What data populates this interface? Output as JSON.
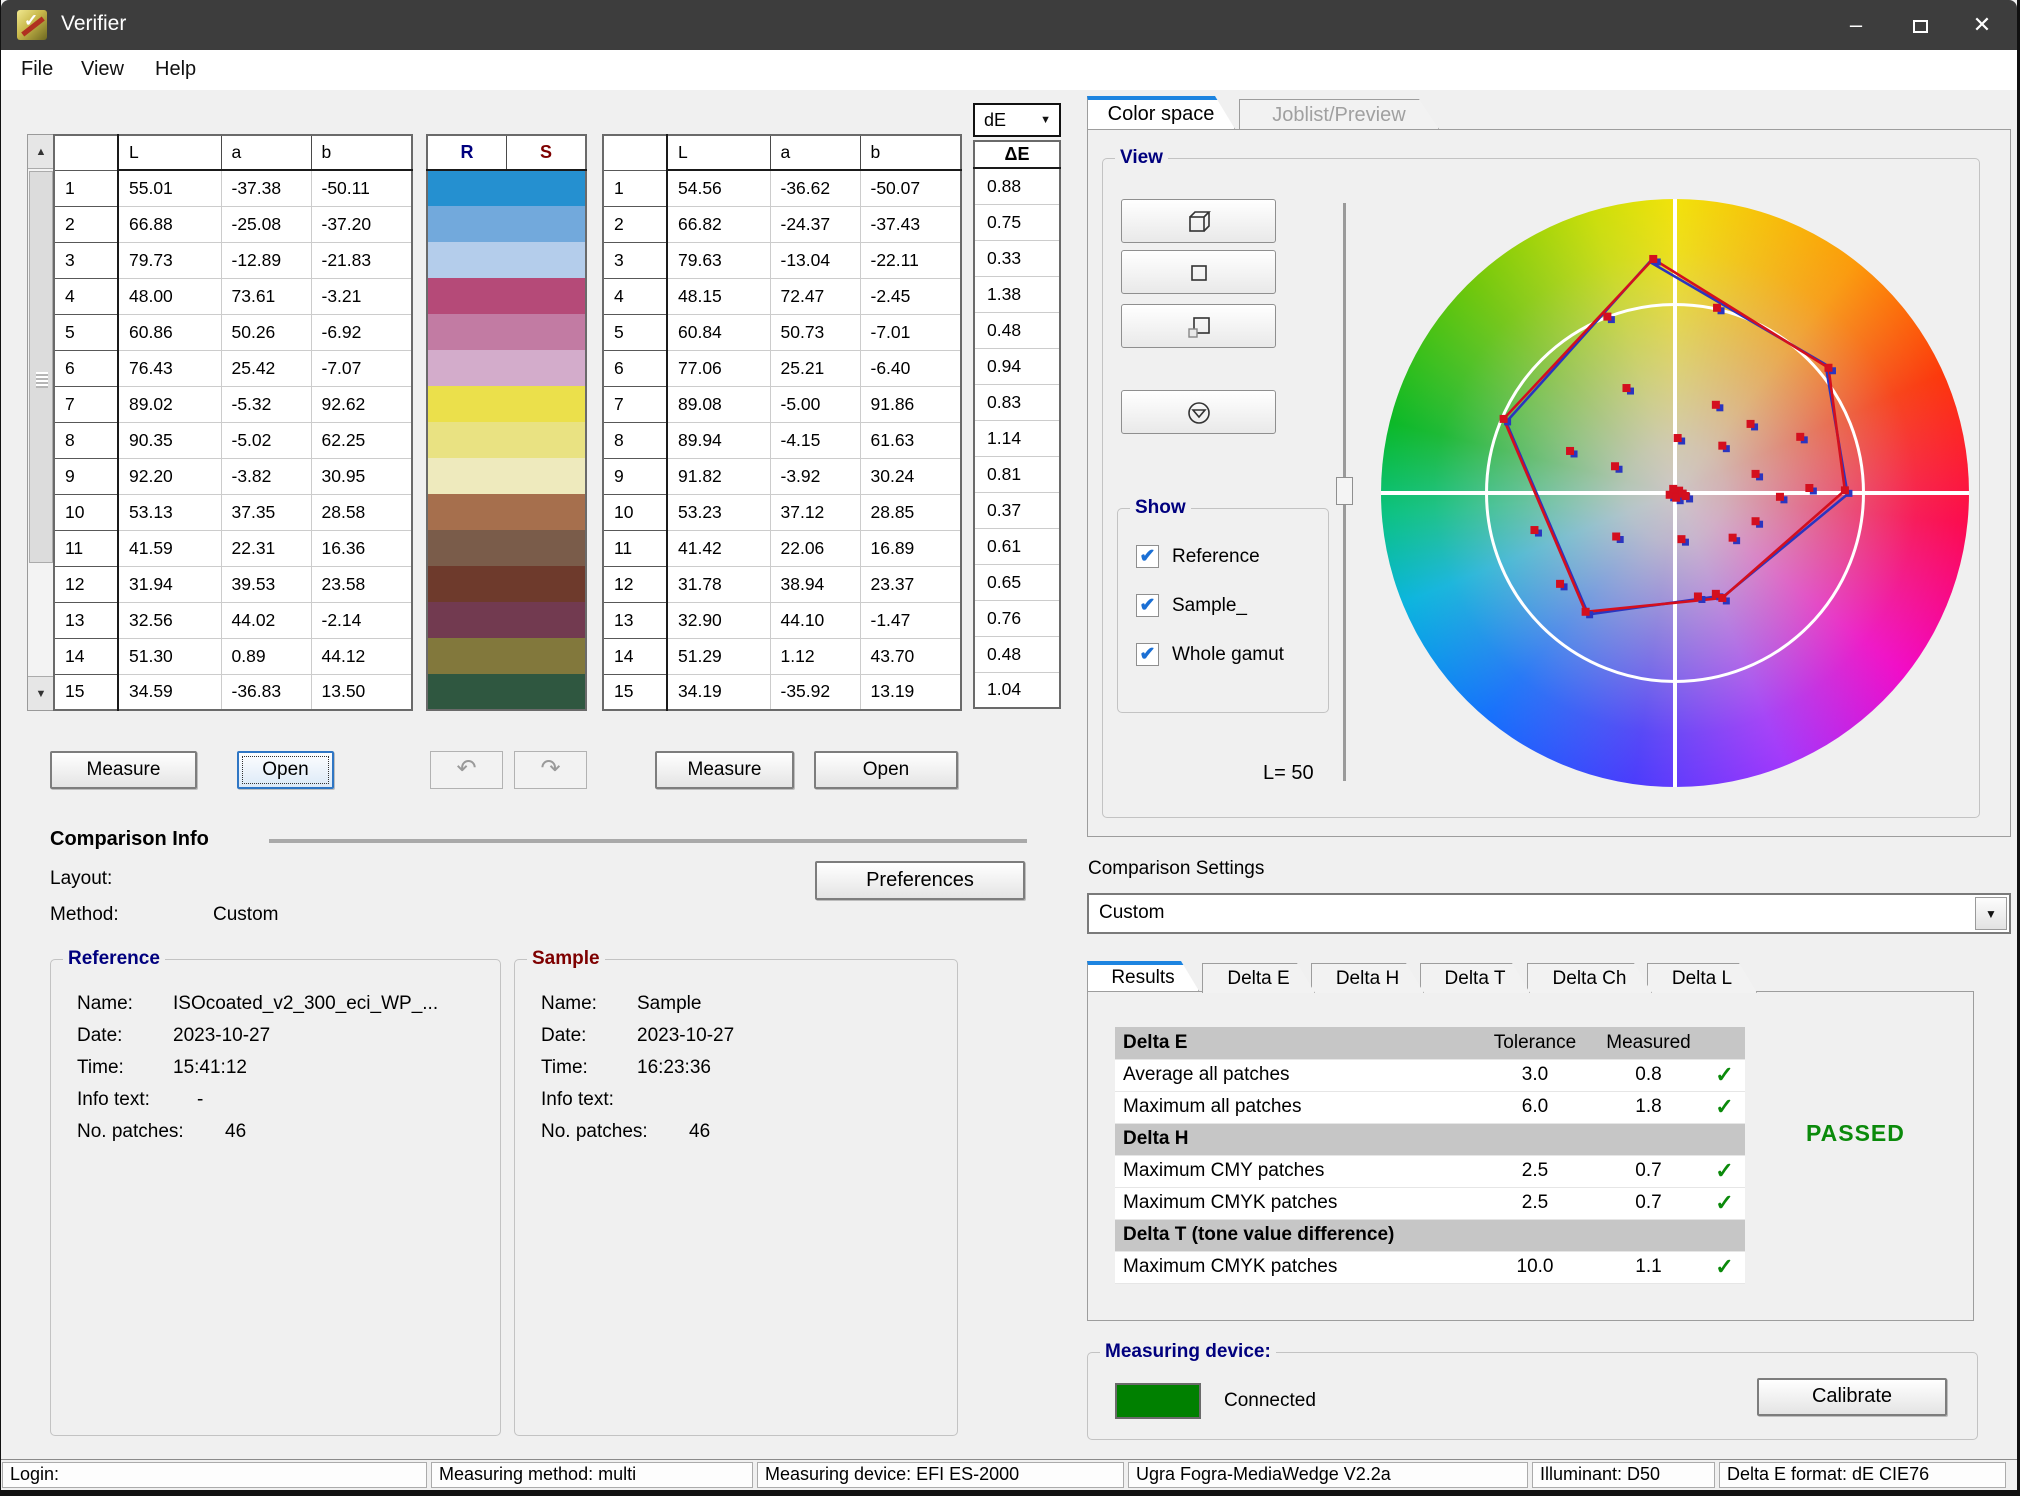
{
  "window": {
    "title": "Verifier",
    "minimize": "–",
    "close": "✕"
  },
  "menu": {
    "items": [
      "File",
      "View",
      "Help"
    ]
  },
  "patch_tables": {
    "ref_headers": {
      "l": "L",
      "a": "a",
      "b": "b"
    },
    "smp_headers": {
      "l": "L",
      "a": "a",
      "b": "b"
    },
    "swatch_headers": {
      "r": "R",
      "s": "S"
    },
    "de_dropdown": "dE",
    "de_header": "ΔE",
    "patches": [
      {
        "idx": 1,
        "ref": [
          "55.01",
          "-37.38",
          "-50.11"
        ],
        "sample": [
          "54.56",
          "-36.62",
          "-50.07"
        ],
        "de": "0.88",
        "color": "#2590d0"
      },
      {
        "idx": 2,
        "ref": [
          "66.88",
          "-25.08",
          "-37.20"
        ],
        "sample": [
          "66.82",
          "-24.37",
          "-37.43"
        ],
        "de": "0.75",
        "color": "#72a9dc"
      },
      {
        "idx": 3,
        "ref": [
          "79.73",
          "-12.89",
          "-21.83"
        ],
        "sample": [
          "79.63",
          "-13.04",
          "-22.11"
        ],
        "de": "0.33",
        "color": "#b4cdeb"
      },
      {
        "idx": 4,
        "ref": [
          "48.00",
          "73.61",
          "-3.21"
        ],
        "sample": [
          "48.15",
          "72.47",
          "-2.45"
        ],
        "de": "1.38",
        "color": "#b54a78"
      },
      {
        "idx": 5,
        "ref": [
          "60.86",
          "50.26",
          "-6.92"
        ],
        "sample": [
          "60.84",
          "50.73",
          "-7.01"
        ],
        "de": "0.48",
        "color": "#c27ba3"
      },
      {
        "idx": 6,
        "ref": [
          "76.43",
          "25.42",
          "-7.07"
        ],
        "sample": [
          "77.06",
          "25.21",
          "-6.40"
        ],
        "de": "0.94",
        "color": "#d3accb"
      },
      {
        "idx": 7,
        "ref": [
          "89.02",
          "-5.32",
          "92.62"
        ],
        "sample": [
          "89.08",
          "-5.00",
          "91.86"
        ],
        "de": "0.83",
        "color": "#ebe04b"
      },
      {
        "idx": 8,
        "ref": [
          "90.35",
          "-5.02",
          "62.25"
        ],
        "sample": [
          "89.94",
          "-4.15",
          "61.63"
        ],
        "de": "1.14",
        "color": "#e9e282"
      },
      {
        "idx": 9,
        "ref": [
          "92.20",
          "-3.82",
          "30.95"
        ],
        "sample": [
          "91.82",
          "-3.92",
          "30.24"
        ],
        "de": "0.81",
        "color": "#eeeabd"
      },
      {
        "idx": 10,
        "ref": [
          "53.13",
          "37.35",
          "28.58"
        ],
        "sample": [
          "53.23",
          "37.12",
          "28.85"
        ],
        "de": "0.37",
        "color": "#a66f4d"
      },
      {
        "idx": 11,
        "ref": [
          "41.59",
          "22.31",
          "16.36"
        ],
        "sample": [
          "41.42",
          "22.06",
          "16.89"
        ],
        "de": "0.61",
        "color": "#7a5c4a"
      },
      {
        "idx": 12,
        "ref": [
          "31.94",
          "39.53",
          "23.58"
        ],
        "sample": [
          "31.78",
          "38.94",
          "23.37"
        ],
        "de": "0.65",
        "color": "#6e3a2c"
      },
      {
        "idx": 13,
        "ref": [
          "32.56",
          "44.02",
          "-2.14"
        ],
        "sample": [
          "32.90",
          "44.10",
          "-1.47"
        ],
        "de": "0.76",
        "color": "#723a50"
      },
      {
        "idx": 14,
        "ref": [
          "51.30",
          "0.89",
          "44.12"
        ],
        "sample": [
          "51.29",
          "1.12",
          "43.70"
        ],
        "de": "0.48",
        "color": "#82783c"
      },
      {
        "idx": 15,
        "ref": [
          "34.59",
          "-36.83",
          "13.50"
        ],
        "sample": [
          "34.19",
          "-35.92",
          "13.19"
        ],
        "de": "1.04",
        "color": "#2f5740"
      }
    ]
  },
  "buttons": {
    "measure_ref": "Measure",
    "open_ref": "Open",
    "undo": "↶",
    "redo": "↷",
    "measure_sample": "Measure",
    "open_sample": "Open",
    "preferences": "Preferences",
    "calibrate": "Calibrate"
  },
  "comparison_info": {
    "title": "Comparison Info",
    "layout_label": "Layout:",
    "method_label": "Method:",
    "method_value": "Custom",
    "reference": {
      "title": "Reference",
      "name_label": "Name:",
      "name": "ISOcoated_v2_300_eci_WP_...",
      "date_label": "Date:",
      "date": "2023-10-27",
      "time_label": "Time:",
      "time": "15:41:12",
      "info_label": "Info text:",
      "info": "-",
      "patches_label": "No. patches:",
      "patches": "46"
    },
    "sample": {
      "title": "Sample",
      "name_label": "Name:",
      "name": "Sample",
      "date_label": "Date:",
      "date": "2023-10-27",
      "time_label": "Time:",
      "time": "16:23:36",
      "info_label": "Info text:",
      "info": "",
      "patches_label": "No. patches:",
      "patches": "46"
    }
  },
  "right_panel": {
    "tabs": [
      "Color space",
      "Joblist/Preview"
    ],
    "view_group_title": "View",
    "show_group": {
      "title": "Show",
      "options": [
        {
          "label": "Reference",
          "checked": true
        },
        {
          "label": "Sample_",
          "checked": true
        },
        {
          "label": "Whole gamut",
          "checked": true
        }
      ]
    },
    "l_label": "L=  50",
    "comparison_settings_label": "Comparison Settings",
    "comparison_settings_value": "Custom",
    "results_tabs": [
      "Results",
      "Delta E",
      "Delta H",
      "Delta T",
      "Delta Ch",
      "Delta L"
    ],
    "results": {
      "rows": [
        {
          "type": "header",
          "label": "Delta E",
          "tolerance": "Tolerance",
          "measured": "Measured"
        },
        {
          "type": "data",
          "label": "Average all patches",
          "tolerance": "3.0",
          "measured": "0.8",
          "pass": true
        },
        {
          "type": "data",
          "label": "Maximum all patches",
          "tolerance": "6.0",
          "measured": "1.8",
          "pass": true
        },
        {
          "type": "header",
          "label": "Delta H",
          "tolerance": "",
          "measured": ""
        },
        {
          "type": "data",
          "label": "Maximum CMY patches",
          "tolerance": "2.5",
          "measured": "0.7",
          "pass": true
        },
        {
          "type": "data",
          "label": "Maximum CMYK patches",
          "tolerance": "2.5",
          "measured": "0.7",
          "pass": true
        },
        {
          "type": "header",
          "label": "Delta T (tone value difference)",
          "tolerance": "",
          "measured": ""
        },
        {
          "type": "data",
          "label": "Maximum CMYK patches",
          "tolerance": "10.0",
          "measured": "1.1",
          "pass": true
        }
      ],
      "status": "PASSED"
    },
    "measuring_device": {
      "title": "Measuring device:",
      "status": "Connected",
      "status_color": "#008000"
    }
  },
  "status_bar": {
    "items": [
      "Login:",
      "Measuring method: multi",
      "Measuring device: EFI ES-2000",
      "Ugra Fogra-MediaWedge V2.2a",
      "Illuminant: D50",
      "Delta E format: dE CIE76"
    ]
  },
  "gamut_view": {
    "colors": {
      "reference": "#d40f1e",
      "sample": "#2a35c0"
    },
    "reference_polygon": [
      [
        -0.074,
        -0.796
      ],
      [
        0.522,
        -0.426
      ],
      [
        0.578,
        -0.009
      ],
      [
        0.161,
        0.357
      ],
      [
        -0.304,
        0.404
      ],
      [
        -0.583,
        -0.252
      ]
    ],
    "sample_polygon": [
      [
        -0.086,
        -0.786
      ],
      [
        0.512,
        -0.437
      ],
      [
        0.587,
        0.004
      ],
      [
        0.17,
        0.348
      ],
      [
        -0.295,
        0.413
      ],
      [
        -0.574,
        -0.241
      ]
    ],
    "points": [
      [
        -0.23,
        -0.6
      ],
      [
        0.143,
        -0.63
      ],
      [
        -0.165,
        -0.357
      ],
      [
        -0.357,
        -0.143
      ],
      [
        -0.204,
        -0.091
      ],
      [
        -0.478,
        0.126
      ],
      [
        -0.391,
        0.309
      ],
      [
        -0.2,
        0.148
      ],
      [
        0.022,
        0.157
      ],
      [
        0.078,
        0.352
      ],
      [
        0.139,
        0.343
      ],
      [
        0.196,
        0.152
      ],
      [
        0.274,
        0.096
      ],
      [
        0.357,
        0.013
      ],
      [
        0.457,
        -0.017
      ],
      [
        0.139,
        -0.3
      ],
      [
        0.257,
        -0.235
      ],
      [
        0.161,
        -0.161
      ],
      [
        0.009,
        -0.187
      ],
      [
        0.274,
        -0.065
      ],
      [
        0.426,
        -0.191
      ],
      [
        -0.074,
        -0.796
      ],
      [
        0.522,
        -0.426
      ],
      [
        0.578,
        -0.009
      ],
      [
        0.161,
        0.357
      ],
      [
        -0.304,
        0.404
      ],
      [
        -0.583,
        -0.252
      ],
      [
        0.0,
        0.0
      ],
      [
        -0.018,
        0.006
      ],
      [
        0.014,
        -0.008
      ],
      [
        0.004,
        0.016
      ],
      [
        -0.006,
        -0.014
      ],
      [
        0.026,
        0.002
      ],
      [
        0.036,
        0.01
      ]
    ]
  }
}
